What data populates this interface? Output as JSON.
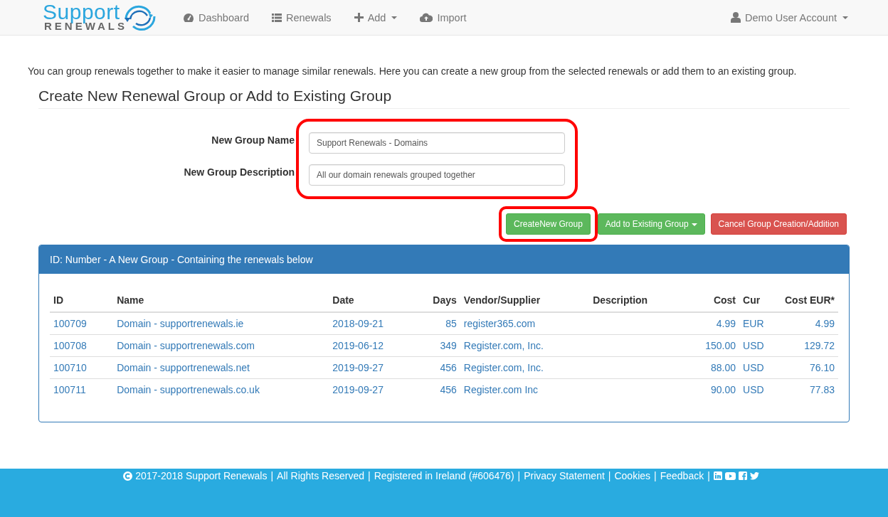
{
  "navbar": {
    "logo": {
      "top": "Support",
      "bottom": "RENEWALS"
    },
    "items": [
      {
        "label": "Dashboard",
        "dropdown": false
      },
      {
        "label": "Renewals",
        "dropdown": false
      },
      {
        "label": "Add",
        "dropdown": true
      },
      {
        "label": "Import",
        "dropdown": false
      }
    ],
    "account": {
      "label": "Demo User Account"
    }
  },
  "intro": "You can group renewals together to make it easier to manage similar renewals. Here you can create a new group from the selected renewals or add them to an existing group.",
  "form": {
    "title": "Create New Renewal Group or Add to Existing Group",
    "highlighted": true,
    "fields": [
      {
        "label": "New Group Name",
        "value": "Support Renewals - Domains"
      },
      {
        "label": "New Group Description",
        "value": "All our domain renewals grouped together"
      }
    ],
    "buttons": [
      {
        "label": "CreateNew Group",
        "kind": "success",
        "dropdown": false,
        "highlighted": true
      },
      {
        "label": "Add to Existing Group",
        "kind": "success",
        "dropdown": true,
        "highlighted": false
      },
      {
        "label": "Cancel Group Creation/Addition",
        "kind": "danger",
        "dropdown": false,
        "highlighted": false
      }
    ]
  },
  "panel": {
    "heading": "ID: Number - A New Group - Containing the renewals below",
    "table": {
      "columns": [
        "ID",
        "Name",
        "Date",
        "Days",
        "Vendor/Supplier",
        "Description",
        "Cost",
        "Cur",
        "Cost EUR*"
      ],
      "rows": [
        [
          "100709",
          "Domain - supportrenewals.ie",
          "2018-09-21",
          "85",
          "register365.com",
          "",
          "4.99",
          "EUR",
          "4.99"
        ],
        [
          "100708",
          "Domain - supportrenewals.com",
          "2019-06-12",
          "349",
          "Register.com, Inc.",
          "",
          "150.00",
          "USD",
          "129.72"
        ],
        [
          "100710",
          "Domain - supportrenewals.net",
          "2019-09-27",
          "456",
          "Register.com, Inc.",
          "",
          "88.00",
          "USD",
          "76.10"
        ],
        [
          "100711",
          "Domain - supportrenewals.co.uk",
          "2019-09-27",
          "456",
          "Register.com Inc",
          "",
          "90.00",
          "USD",
          "77.83"
        ]
      ]
    }
  },
  "footer": {
    "items": [
      "2017-2018 Support Renewals",
      "|",
      "All Rights Reserved",
      "|",
      "Registered in Ireland (#606476)",
      "|",
      "Privacy Statement",
      "|",
      "Cookies",
      "|",
      "Feedback",
      "|"
    ]
  }
}
